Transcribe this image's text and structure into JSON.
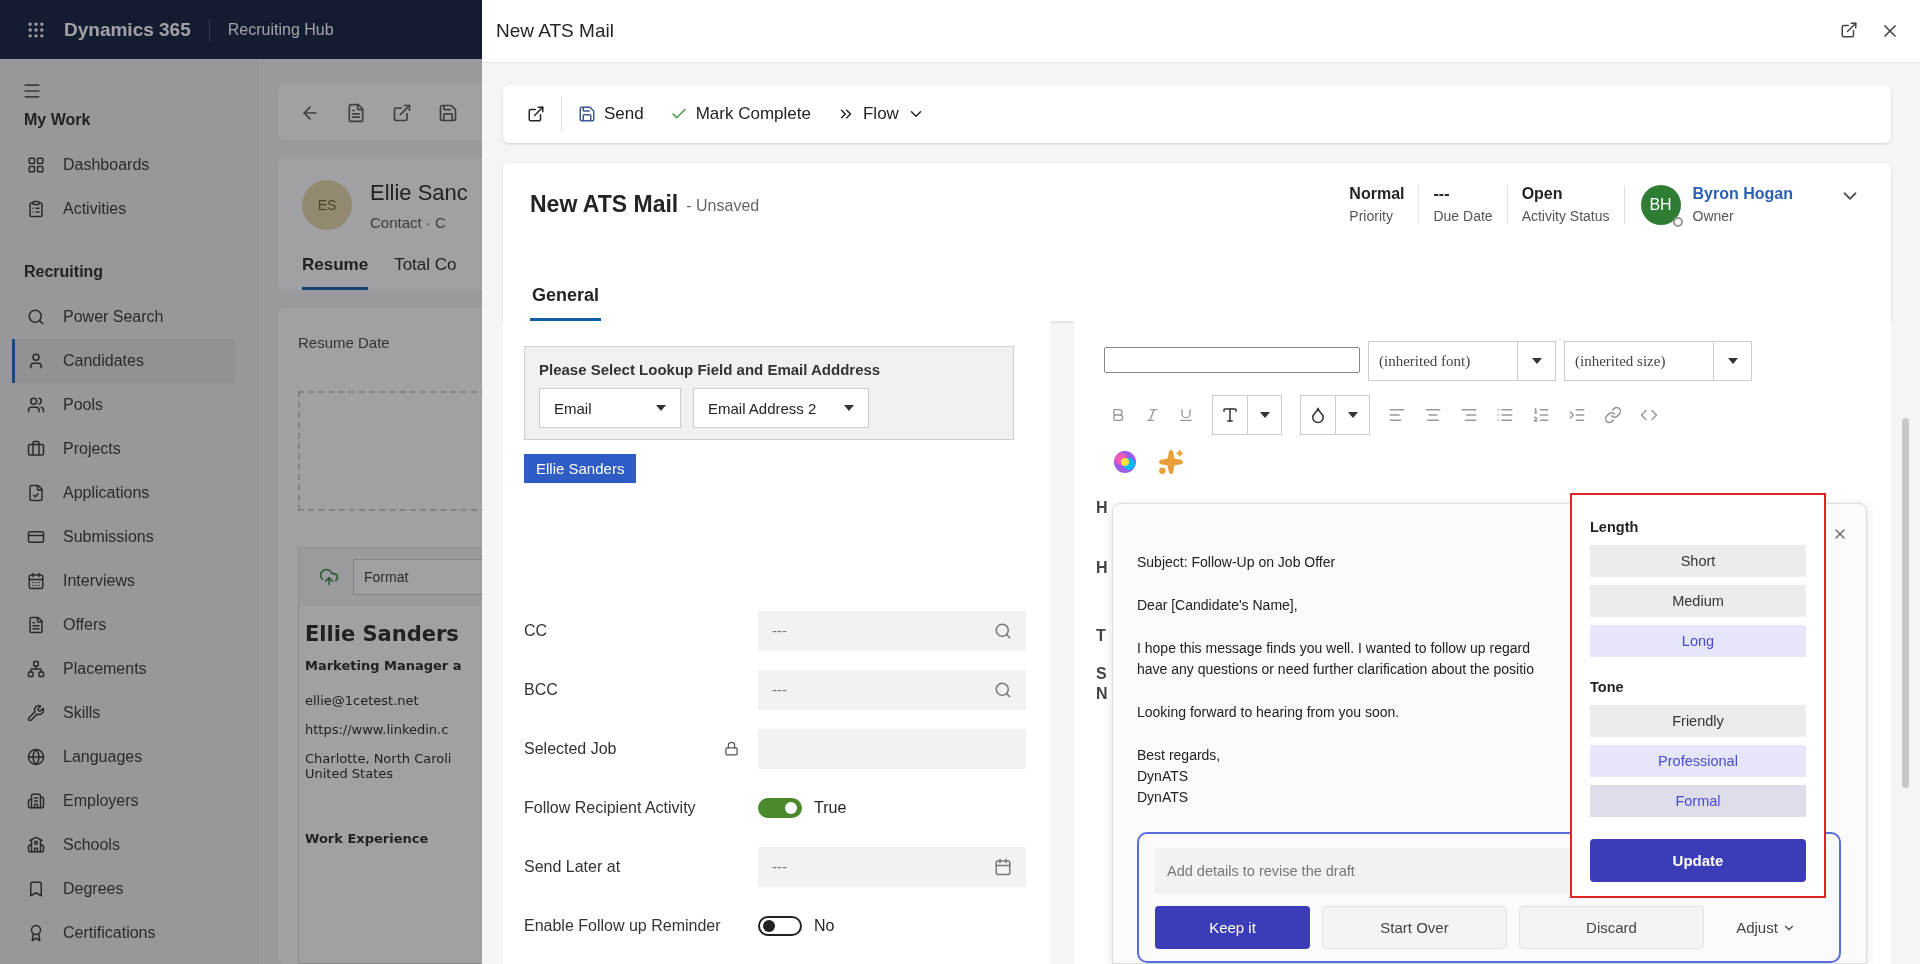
{
  "app_bar": {
    "product": "Dynamics 365",
    "area": "Recruiting Hub"
  },
  "sidebar": {
    "groups": [
      {
        "title": "My Work",
        "items": [
          {
            "label": "Dashboards",
            "selected": false
          },
          {
            "label": "Activities",
            "selected": false
          }
        ]
      },
      {
        "title": "Recruiting",
        "items": [
          {
            "label": "Power Search",
            "selected": false
          },
          {
            "label": "Candidates",
            "selected": true
          },
          {
            "label": "Pools",
            "selected": false
          },
          {
            "label": "Projects",
            "selected": false
          },
          {
            "label": "Applications",
            "selected": false
          },
          {
            "label": "Submissions",
            "selected": false
          },
          {
            "label": "Interviews",
            "selected": false
          },
          {
            "label": "Offers",
            "selected": false
          },
          {
            "label": "Placements",
            "selected": false
          },
          {
            "label": "Skills",
            "selected": false
          },
          {
            "label": "Languages",
            "selected": false
          },
          {
            "label": "Employers",
            "selected": false
          },
          {
            "label": "Schools",
            "selected": false
          },
          {
            "label": "Degrees",
            "selected": false
          },
          {
            "label": "Certifications",
            "selected": false
          }
        ]
      }
    ]
  },
  "record": {
    "avatar": "ES",
    "name": "Ellie Sanc",
    "subtitle": "Contact · C",
    "tabs": [
      {
        "label": "Resume",
        "selected": true
      },
      {
        "label": "Total Co",
        "selected": false
      }
    ],
    "resume_date_label": "Resume Date",
    "format_placeholder": "Format",
    "resume_lines": [
      {
        "kind": "name",
        "text": "Ellie Sanders"
      },
      {
        "kind": "title",
        "text": "Marketing Manager a"
      },
      {
        "kind": "text",
        "text": "ellie@1cetest.net"
      },
      {
        "kind": "text",
        "text": "https://www.linkedin.c"
      },
      {
        "kind": "text",
        "text": "Charlotte, North Caroli\nUnited States"
      },
      {
        "kind": "heading",
        "text": "Work Experience"
      }
    ]
  },
  "dialog": {
    "title": "New ATS Mail",
    "commands": [
      {
        "kind": "popout"
      },
      {
        "kind": "save",
        "label": "Send"
      },
      {
        "kind": "check",
        "label": "Mark Complete"
      },
      {
        "kind": "flow",
        "label": "Flow"
      }
    ],
    "header": {
      "title": "New ATS Mail",
      "status": "- Unsaved",
      "fields": [
        {
          "value": "Normal",
          "label": "Priority"
        },
        {
          "value": "---",
          "label": "Due Date"
        },
        {
          "value": "Open",
          "label": "Activity Status"
        }
      ],
      "owner": {
        "initials": "BH",
        "name": "Byron Hogan",
        "label": "Owner"
      }
    },
    "form_tabs": [
      {
        "label": "General",
        "selected": true
      }
    ],
    "to": {
      "lookup_title": "Please Select Lookup Field and Email Adddress",
      "selects": [
        "Email",
        "Email Address 2"
      ],
      "recipient": "Ellie Sanders"
    },
    "fields": [
      {
        "kind": "lookup",
        "label": "CC",
        "placeholder": "---"
      },
      {
        "kind": "lookup",
        "label": "BCC",
        "placeholder": "---"
      },
      {
        "kind": "locked",
        "label": "Selected Job"
      },
      {
        "kind": "toggle",
        "label": "Follow Recipient Activity",
        "on": true,
        "value": "True"
      },
      {
        "kind": "date",
        "label": "Send Later at",
        "placeholder": "---"
      },
      {
        "kind": "toggle",
        "label": "Enable Follow up Reminder",
        "on": false,
        "value": "No"
      }
    ],
    "editor": {
      "font": "(inherited font)",
      "size": "(inherited size)",
      "behind_text": [
        "H",
        "H",
        "T",
        "S",
        "N"
      ],
      "copilot": {
        "draft": [
          "Subject: Follow-Up on Job Offer",
          "Dear [Candidate's Name],",
          "I hope this message finds you well. I wanted to follow up regard\nhave any questions or need further clarification about the positio",
          "Looking forward to hearing from you soon.",
          "Best regards,\nDynATS\nDynATS"
        ],
        "placeholder": "Add details to revise the draft",
        "actions": [
          {
            "kind": "primary",
            "label": "Keep it"
          },
          {
            "kind": "secondary",
            "label": "Start Over"
          },
          {
            "kind": "secondary",
            "label": "Discard"
          },
          {
            "kind": "menu",
            "label": "Adjust"
          }
        ],
        "adjust": {
          "sections": [
            {
              "title": "Length",
              "options": [
                {
                  "label": "Short",
                  "selected": false,
                  "hovered": false
                },
                {
                  "label": "Medium",
                  "selected": false,
                  "hovered": false
                },
                {
                  "label": "Long",
                  "selected": true,
                  "hovered": false
                }
              ]
            },
            {
              "title": "Tone",
              "options": [
                {
                  "label": "Friendly",
                  "selected": false,
                  "hovered": false
                },
                {
                  "label": "Professional",
                  "selected": true,
                  "hovered": false
                },
                {
                  "label": "Formal",
                  "selected": false,
                  "hovered": true
                }
              ]
            }
          ],
          "update": "Update"
        }
      }
    }
  }
}
